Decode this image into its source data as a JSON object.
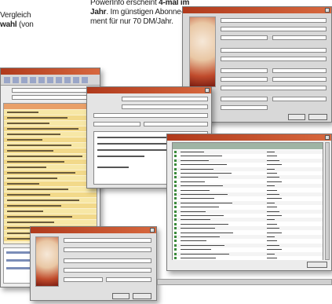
{
  "brochure": {
    "left_line1": "Vergleich",
    "left_line2_bold": "wahl",
    "left_line2_rest": " (von",
    "right_line1": "PowerInfo erscheint ",
    "right_line1_bold": "4-mal im",
    "right_line2_bold": "Jahr",
    "right_line2_rest": ". Im günstigen Abonne-",
    "right_line3": "ment für nur 70 DM/Jahr."
  },
  "colors": {
    "titlebar": "#b03a1c",
    "list_header": "#e9a069",
    "list_row_yellow": "#f7e7a6",
    "list_row_yellow_alt": "#f2d98a"
  },
  "icons": {
    "logo": "paint-splash-logo",
    "close": "close-icon",
    "folder": "folder-icon"
  },
  "main_list_rows": 24,
  "table_rows": 26
}
